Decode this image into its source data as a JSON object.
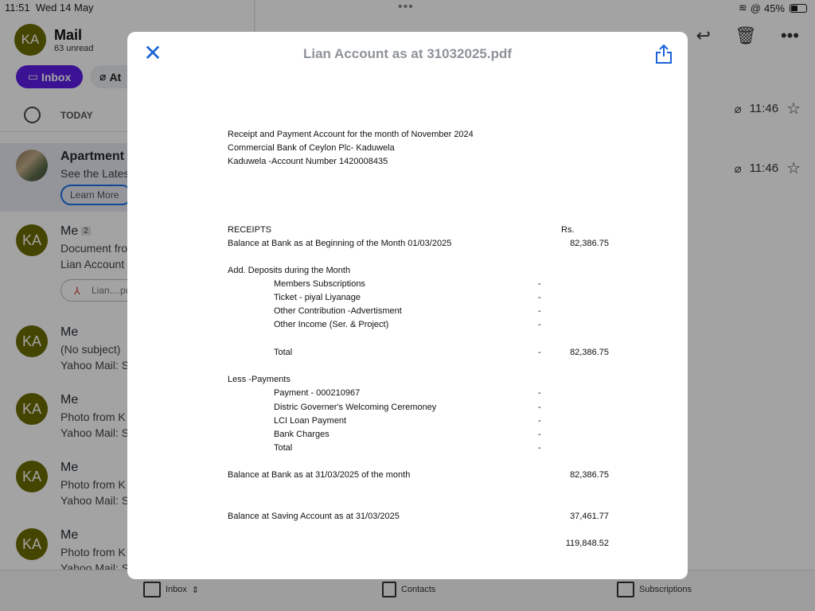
{
  "status_bar": {
    "time": "11:51",
    "date": "Wed 14 May",
    "battery": "45%",
    "battery_level": 0.45
  },
  "mail": {
    "title": "Mail",
    "unread": "63 unread",
    "avatar_initials": "KA",
    "filters": {
      "inbox": "Inbox",
      "attachments": "At"
    },
    "section": "TODAY"
  },
  "messages": [
    {
      "sender": "Apartment",
      "line2": "See the Lates",
      "button": "Learn More",
      "time": "11:46"
    },
    {
      "sender": "Me",
      "badge": "2",
      "line2": "Document fro",
      "line3": "Lian Account",
      "attachment": "Lian....pd",
      "time": "11:46"
    },
    {
      "sender": "Me",
      "line2": "(No subject)",
      "line3": "Yahoo Mail: S"
    },
    {
      "sender": "Me",
      "line2": "Photo from K",
      "line3": "Yahoo Mail: S"
    },
    {
      "sender": "Me",
      "line2": "Photo from K",
      "line3": "Yahoo Mail: S"
    },
    {
      "sender": "Me",
      "line2": "Photo from K",
      "line3": "Yahoo Mail: S"
    }
  ],
  "bottom_tabs": {
    "inbox": "Inbox",
    "contacts": "Contacts",
    "subscriptions": "Subscriptions"
  },
  "modal": {
    "title": "Lian Account as at 31032025.pdf"
  },
  "document": {
    "header": [
      "Receipt and Payment Account for the month of November 2024",
      "Commercial Bank of Ceylon Plc- Kaduwela",
      "Kaduwela -Account Number  1420008435"
    ],
    "receipts_label": "RECEIPTS",
    "currency": "Rs.",
    "opening_label": "Balance at Bank as at Beginning of the Month 01/03/2025",
    "opening_value": "82,386.75",
    "deposits_label": "Add. Deposits during the Month",
    "deposit_items": [
      {
        "label": "Members Subscriptions",
        "mid": "-"
      },
      {
        "label": "Ticket -    piyal Liyanage",
        "mid": "-"
      },
      {
        "label": "Other Contribution -Advertisment",
        "mid": "-"
      },
      {
        "label": "Other Income (Ser. & Project)",
        "mid": "-"
      }
    ],
    "deposits_total_label": "Total",
    "deposits_total_mid": "-",
    "deposits_total_value": "82,386.75",
    "payments_label": "Less -Payments",
    "payment_items": [
      {
        "label": "Payment - 000210967",
        "mid": "-"
      },
      {
        "label": "Distric Governer's Welcoming Ceremoney",
        "mid": "-"
      },
      {
        "label": "LCI Loan Payment",
        "mid": "-"
      },
      {
        "label": "Bank Charges",
        "mid": "-"
      },
      {
        "label": "Total",
        "mid": "-"
      }
    ],
    "closing_label": "Balance at Bank as at 31/03/2025 of the month",
    "closing_value": "82,386.75",
    "saving_label": "Balance at Saving Account as at 31/03/2025",
    "saving_value": "37,461.77",
    "grand_total": "119,848.52"
  }
}
